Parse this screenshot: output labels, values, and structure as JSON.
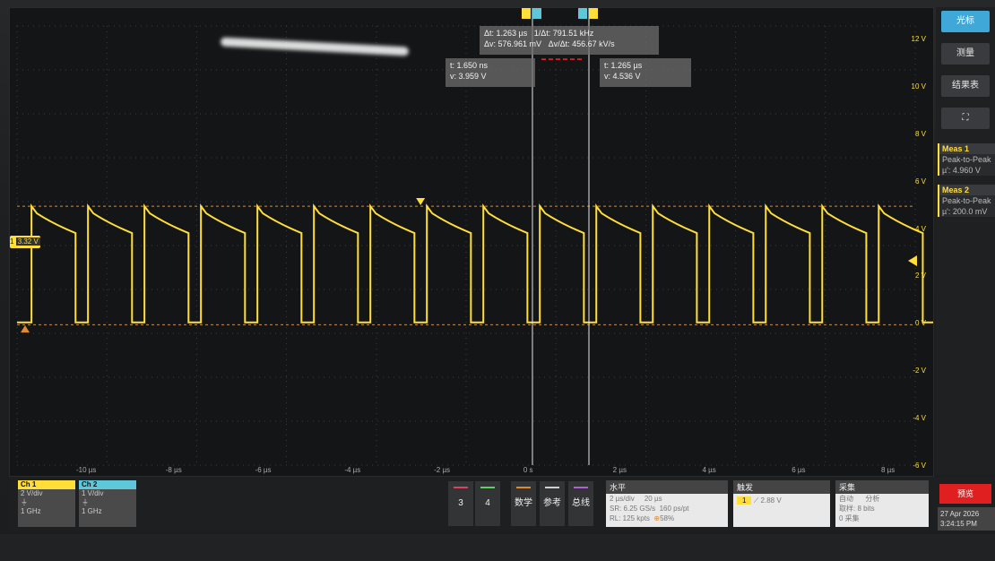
{
  "cursor_readout": {
    "dt": "Δt: 1.263 µs",
    "inv_dt": "1/Δt: 791.51 kHz",
    "dv": "Δv: 576.961 mV",
    "dvdt": "Δv/Δt: 456.67 kV/s"
  },
  "cursor_a": {
    "t": "t: 1.650 ns",
    "v": "v: 3.959 V"
  },
  "cursor_b": {
    "t": "t: 1.265 µs",
    "v": "v: 4.536 V"
  },
  "ch1_level_label": "3.32 V",
  "ch1_marker_label": "1",
  "x_ticks": [
    "-10 µs",
    "-8 µs",
    "-6 µs",
    "-4 µs",
    "-2 µs",
    "0 s",
    "2 µs",
    "4 µs",
    "6 µs",
    "8 µs"
  ],
  "y_ticks": [
    "12 V",
    "10 V",
    "8 V",
    "6 V",
    "4 V",
    "2 V",
    "0 V",
    "-2 V",
    "-4 V",
    "-6 V"
  ],
  "sidebar": {
    "cursor_btn": "光标",
    "measure_btn": "测量",
    "results_btn": "结果表",
    "meas1": {
      "title": "Meas 1",
      "label": "Peak-to-Peak",
      "value": "µ': 4.960 V"
    },
    "meas2": {
      "title": "Meas 2",
      "label": "Peak-to-Peak",
      "value": "µ': 200.0 mV"
    }
  },
  "ch1": {
    "title": "Ch 1",
    "scale": "2 V/div",
    "bw": "1 GHz"
  },
  "ch2": {
    "title": "Ch 2",
    "scale": "1 V/div",
    "bw": "1 GHz"
  },
  "buttons": {
    "b3": "3",
    "b4": "4",
    "math": "数学",
    "ref": "参考",
    "bus": "总线"
  },
  "horizontal": {
    "title": "水平",
    "scale": "2 µs/div",
    "length": "20 µs",
    "sr": "SR: 6.25 GS/s",
    "pt": "160 ps/pt",
    "rl": "RL: 125 kpts",
    "pos": "58%"
  },
  "trigger": {
    "title": "触发",
    "ch": "1",
    "level": "2.88 V"
  },
  "acquire": {
    "title": "采集",
    "mode": "自动",
    "analyze": "分析",
    "bits": "取样: 8 bits",
    "acq": "0 采集"
  },
  "preview_btn": "预览",
  "date": "27 Apr 2026",
  "time": "3:24:15 PM",
  "colors": {
    "ch1": "#ffde3a",
    "ch2": "#5ec8d8",
    "accent": "#3fa8d8"
  }
}
